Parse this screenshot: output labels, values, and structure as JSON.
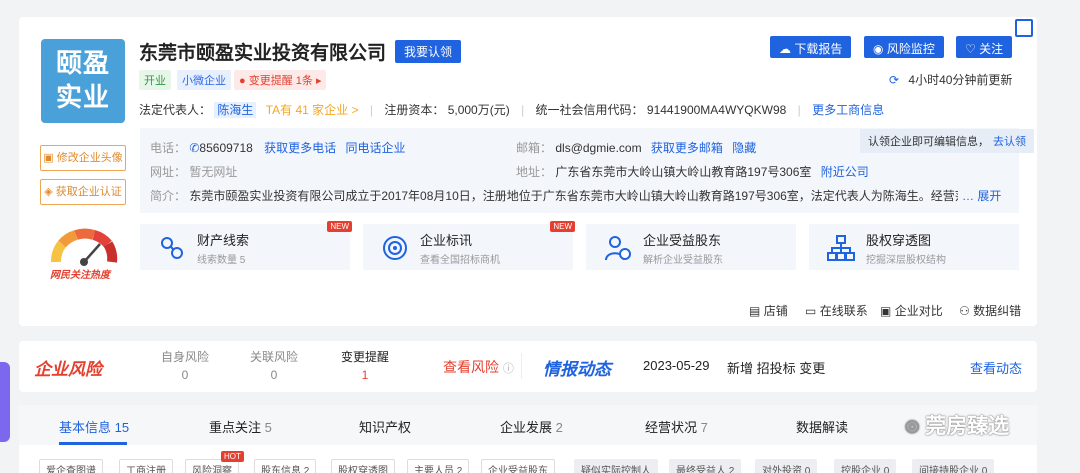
{
  "company": {
    "logo_text_line1": "颐盈",
    "logo_text_line2": "实业",
    "name": "东莞市颐盈实业投资有限公司",
    "claim_button": "我要认领",
    "tags": [
      "开业",
      "小微企业",
      "变更提醒 1条"
    ],
    "legal_rep_label": "法定代表人：",
    "legal_rep_name": "陈海生",
    "legal_rep_link": "TA有 41 家企业 >",
    "capital_label": "注册资本：",
    "capital_value": "5,000万(元)",
    "credit_code_label": "统一社会信用代码：",
    "credit_code_value": "91441900MA4WYQKW98",
    "more_info_link": "更多工商信息"
  },
  "actions": {
    "download": "下载报告",
    "monitor": "风险监控",
    "follow": "关注",
    "update_time": "4小时40分钟前更新"
  },
  "contact": {
    "phone_label": "电话：",
    "phone_value": "85609718",
    "phone_more": "获取更多电话",
    "phone_same": "同电话企业",
    "email_label": "邮箱：",
    "email_value": "dls@dgmie.com",
    "email_more": "获取更多邮箱",
    "email_hide": "隐藏",
    "site_label": "网址：",
    "site_value": "暂无网址",
    "address_label": "地址：",
    "address_value": "广东省东莞市大岭山镇大岭山教育路197号306室",
    "address_nearby": "附近公司",
    "intro_label": "简介：",
    "intro_value": "东莞市颐盈实业投资有限公司成立于2017年08月10日，注册地位于广东省东莞市大岭山镇大岭山教育路197号306室，法定代表人为陈海生。经营范围",
    "intro_expand": "… 展开",
    "claim_note": "认领企业即可编辑信息，",
    "claim_note_link": "去认领"
  },
  "side": {
    "edit_avatar": "修改企业头像",
    "get_cert": "获取企业认证",
    "heat_label": "网民关注热度"
  },
  "features": [
    {
      "title": "财产线索",
      "sub": "线索数量 5",
      "badge": "NEW"
    },
    {
      "title": "企业标讯",
      "sub": "查看全国招标商机",
      "badge": "NEW"
    },
    {
      "title": "企业受益股东",
      "sub": "解析企业受益股东",
      "badge": ""
    },
    {
      "title": "股权穿透图",
      "sub": "挖掘深层股权结构",
      "badge": ""
    }
  ],
  "bottom_links": [
    "店铺",
    "在线联系",
    "企业对比",
    "数据纠错"
  ],
  "risk": {
    "title": "企业风险",
    "items": [
      {
        "label": "自身风险",
        "value": "0"
      },
      {
        "label": "关联风险",
        "value": "0"
      },
      {
        "label": "变更提醒",
        "value": "1"
      }
    ],
    "view_link": "查看风险",
    "intel_title": "情报动态",
    "intel_date": "2023-05-29",
    "intel_text": "新增 招投标 变更",
    "intel_link": "查看动态"
  },
  "tabs": [
    {
      "label": "基本信息",
      "count": "15"
    },
    {
      "label": "重点关注",
      "count": "5"
    },
    {
      "label": "知识产权",
      "count": ""
    },
    {
      "label": "企业发展",
      "count": "2"
    },
    {
      "label": "经营状况",
      "count": "7"
    },
    {
      "label": "数据解读",
      "count": ""
    }
  ],
  "subtabs": [
    "爱企查图谱",
    "工商注册",
    "风险洞察",
    "股东信息 2",
    "股权穿透图",
    "主要人员 2",
    "企业受益股东",
    "疑似实际控制人",
    "最终受益人 2",
    "对外投资 0",
    "控股企业 0",
    "间接持股企业 0"
  ],
  "subtab_hot": "HOT",
  "watermark": "莞房臻选",
  "colors": {
    "primary": "#1f63e0",
    "risk_red": "#e5402f",
    "logo_bg": "#4aa0d8"
  }
}
